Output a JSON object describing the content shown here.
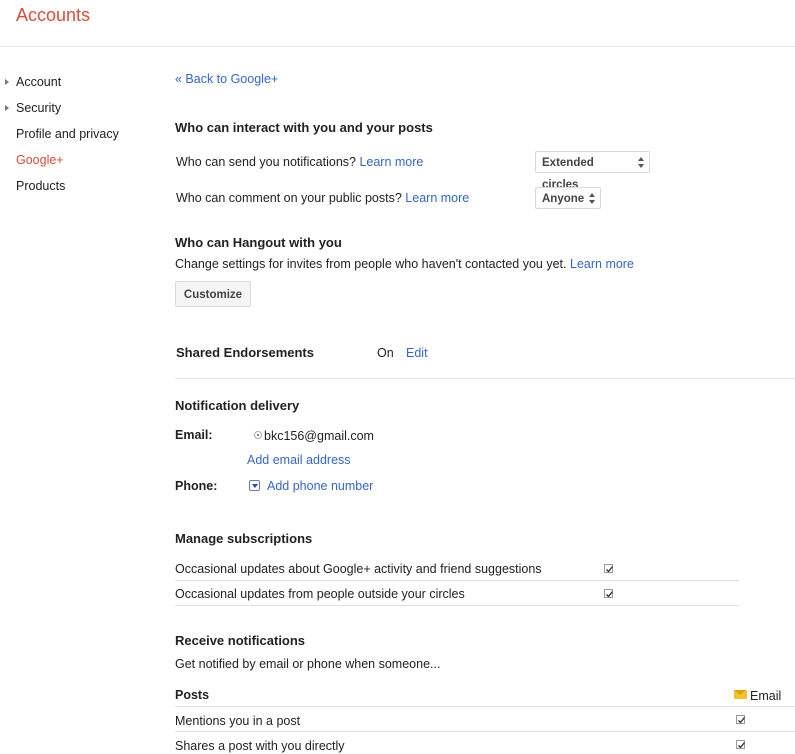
{
  "header": {
    "title": "Accounts"
  },
  "sidebar": {
    "items": [
      {
        "label": "Account"
      },
      {
        "label": "Security"
      },
      {
        "label": "Profile and privacy"
      },
      {
        "label": "Google+"
      },
      {
        "label": "Products"
      }
    ],
    "active": "Google+"
  },
  "main": {
    "back_link": "« Back to Google+",
    "interact": {
      "heading": "Who can interact with you and your posts",
      "notifications_question": "Who can send you notifications?",
      "notifications_learn_more": "Learn more",
      "notifications_value": "Extended circles",
      "comment_question": "Who can comment on your public posts?",
      "comment_learn_more": "Learn more",
      "comment_value": "Anyone"
    },
    "hangout": {
      "heading": "Who can Hangout with you",
      "description": "Change settings for invites from people who haven't contacted you yet.",
      "learn_more": "Learn more",
      "customize_label": "Customize"
    },
    "endorsements": {
      "label": "Shared Endorsements",
      "status": "On",
      "edit_label": "Edit"
    },
    "delivery": {
      "heading": "Notification delivery",
      "email_label": "Email:",
      "email_value": "bkc156@gmail.com",
      "add_email": "Add email address",
      "phone_label": "Phone:",
      "add_phone": "Add phone number"
    },
    "subscriptions": {
      "heading": "Manage subscriptions",
      "items": [
        {
          "label": "Occasional updates about Google+ activity and friend suggestions",
          "checked": true
        },
        {
          "label": "Occasional updates from people outside your circles",
          "checked": true
        }
      ]
    },
    "receive": {
      "heading": "Receive notifications",
      "description": "Get notified by email or phone when someone...",
      "posts_heading": "Posts",
      "email_column": "Email",
      "items": [
        {
          "label": "Mentions you in a post",
          "checked": true
        },
        {
          "label": "Shares a post with you directly",
          "checked": true
        }
      ]
    }
  },
  "colors": {
    "accent": "#dd4b39",
    "link": "#3366cc"
  }
}
